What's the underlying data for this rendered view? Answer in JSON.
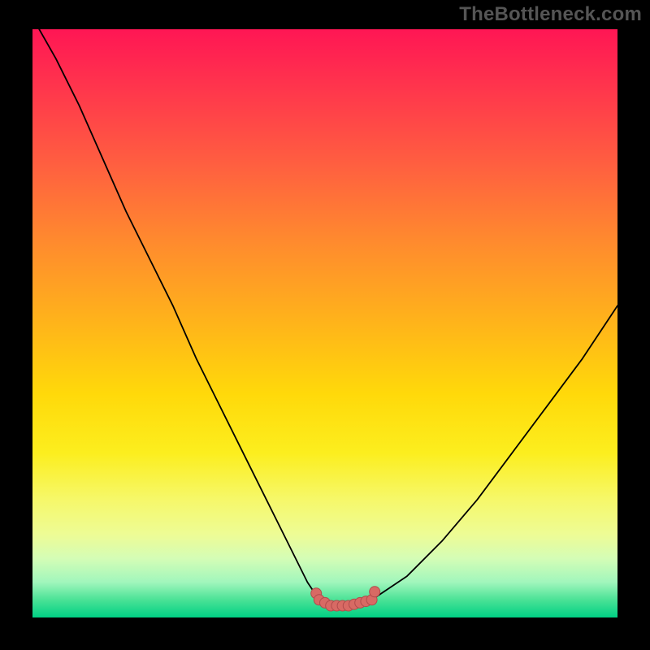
{
  "watermark": "TheBottleneck.com",
  "colors": {
    "frame_bg": "#000000",
    "curve": "#000000",
    "dot_fill": "#d86a64",
    "dot_stroke": "#b14c4c"
  },
  "chart_data": {
    "type": "line",
    "title": "",
    "xlabel": "",
    "ylabel": "",
    "xlim": [
      0,
      100
    ],
    "ylim": [
      0,
      100
    ],
    "x": [
      0,
      4,
      8,
      12,
      16,
      20,
      24,
      28,
      32,
      36,
      40,
      44,
      47,
      49,
      51,
      54,
      58,
      64,
      70,
      76,
      82,
      88,
      94,
      100
    ],
    "values": [
      102,
      95,
      87,
      78,
      69,
      61,
      53,
      44,
      36,
      28,
      20,
      12,
      6,
      3,
      2,
      2,
      3,
      7,
      13,
      20,
      28,
      36,
      44,
      53
    ],
    "minimum_region_x": [
      49,
      58
    ],
    "series": [
      {
        "name": "bottleneck-curve",
        "x": [
          0,
          4,
          8,
          12,
          16,
          20,
          24,
          28,
          32,
          36,
          40,
          44,
          47,
          49,
          51,
          54,
          58,
          64,
          70,
          76,
          82,
          88,
          94,
          100
        ],
        "y": [
          102,
          95,
          87,
          78,
          69,
          61,
          53,
          44,
          36,
          28,
          20,
          12,
          6,
          3,
          2,
          2,
          3,
          7,
          13,
          20,
          28,
          36,
          44,
          53
        ]
      }
    ]
  }
}
